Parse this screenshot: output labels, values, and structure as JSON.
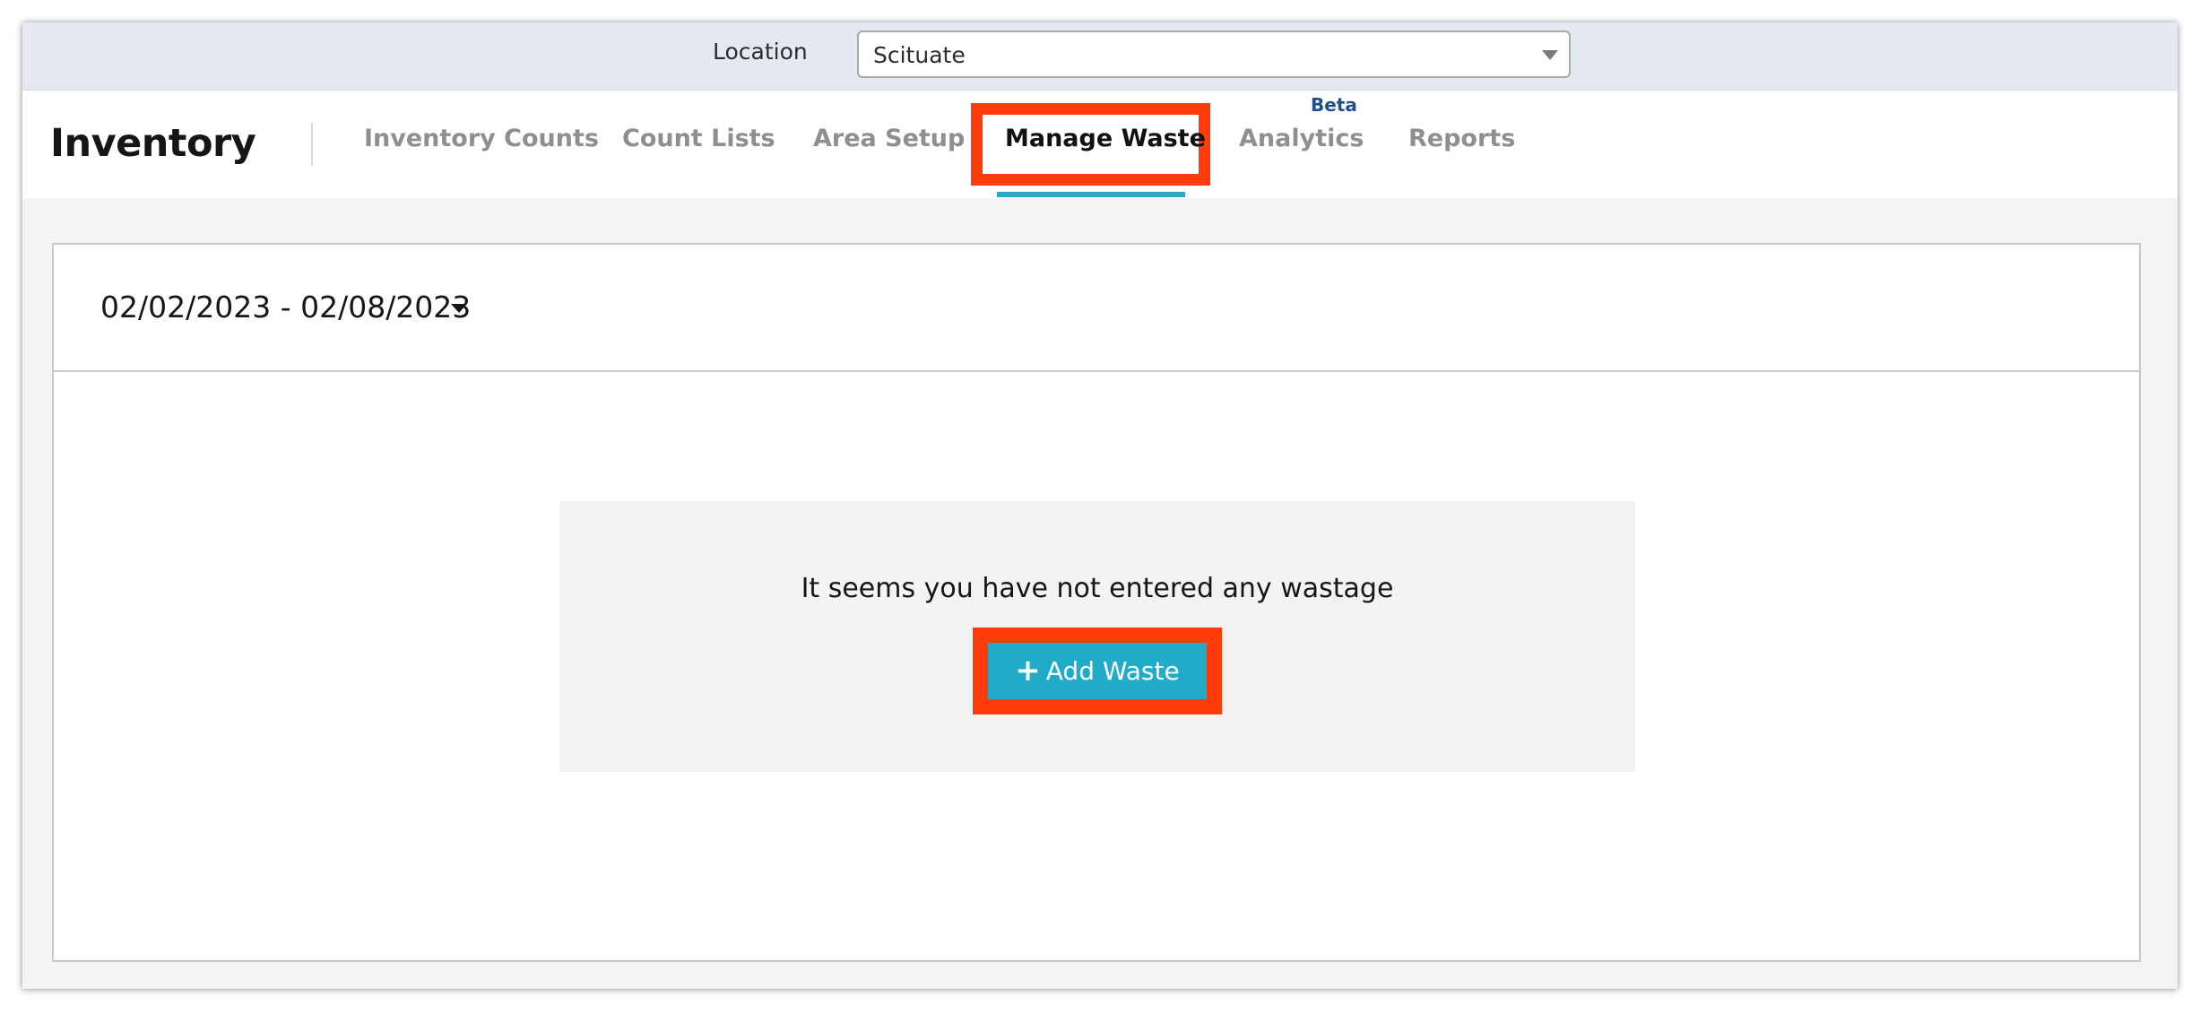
{
  "location": {
    "label": "Location",
    "selected": "Scituate"
  },
  "nav": {
    "app_title": "Inventory",
    "tabs": [
      {
        "label": "Inventory Counts",
        "active": false
      },
      {
        "label": "Count Lists",
        "active": false
      },
      {
        "label": "Area Setup",
        "active": false
      },
      {
        "label": "Manage Waste",
        "active": true
      },
      {
        "label": "Analytics",
        "active": false,
        "badge": "Beta"
      },
      {
        "label": "Reports",
        "active": false
      }
    ]
  },
  "waste": {
    "date_range": "02/02/2023 - 02/08/2023",
    "empty_message": "It seems you have not entered any wastage",
    "add_button_label": "Add Waste",
    "add_button_icon": "plus-icon"
  },
  "colors": {
    "accent": "#20abc8",
    "highlight": "#ff3b0a",
    "header_bg": "#e4e9f1",
    "beta": "#1f4e8c"
  }
}
